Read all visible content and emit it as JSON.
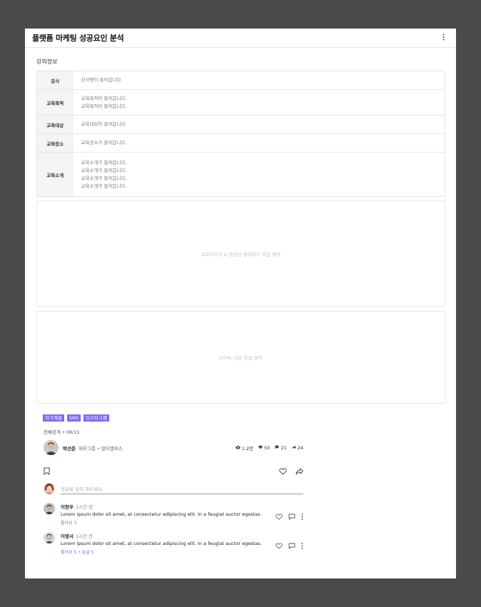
{
  "header": {
    "title": "플랫폼 마케팅 성공요인 분석",
    "more_icon": "more-vertical-icon"
  },
  "section_title": "강의정보",
  "info_rows": [
    {
      "key": "강사",
      "lines": [
        "강사명이 들어갑니다."
      ]
    },
    {
      "key": "교육목적",
      "lines": [
        "교육목적이 들어갑니다.",
        "교육목적이 들어갑니다."
      ]
    },
    {
      "key": "교육대상",
      "lines": [
        "교육대상이 들어갑니다."
      ]
    },
    {
      "key": "교육장소",
      "lines": [
        "교육장소가 들어갑니다."
      ]
    },
    {
      "key": "교육소개",
      "lines": [
        "교육소개가 들어갑니다.",
        "교육소개가 들어갑니다.",
        "교육소개가 들어갑니다.",
        "교육소개가 들어갑니다."
      ]
    }
  ],
  "media_placeholder": "포토이미지 & 동영상 플레이어 추입 영역",
  "html_placeholder": "HTML 내용 추입 영역",
  "tags": [
    "자기계발",
    "SNS",
    "인스타그램"
  ],
  "meta": "전체공개 • 08/11",
  "author": {
    "name": "박선준",
    "org": "재무그룹 • 멀티캠퍼스"
  },
  "stats": {
    "views": "1.2만",
    "likes": "50",
    "comments": "21",
    "shares": "24"
  },
  "comment_input": {
    "placeholder": "댓글을 입력 해주세요"
  },
  "comments": [
    {
      "name": "이현우",
      "time": "1시간 전",
      "text": "Lorem ipsum dolor sit amet, at consectetur adipiscing elit. In a feugiat auctor egestas.",
      "sub": "좋아요 3"
    },
    {
      "name": "이영서",
      "time": "1시간 전",
      "text": "Lorem ipsum dolor sit amet, at consectetur adipiscing elit. In a feugiat auctor egestas.",
      "sub": "좋아요 5 • 답글 5"
    }
  ],
  "colors": {
    "accent": "#7b6cf0",
    "background": "#4a4a4a"
  }
}
